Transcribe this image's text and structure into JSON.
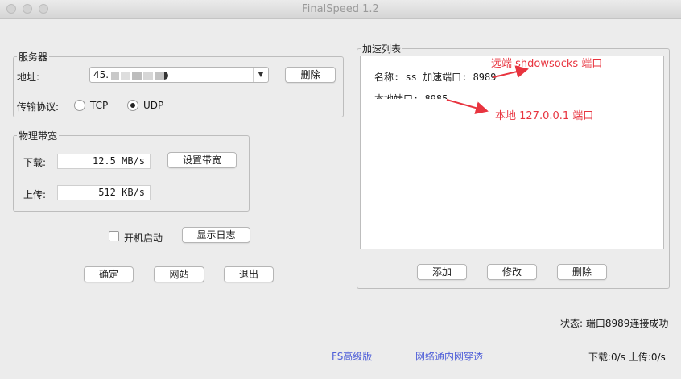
{
  "window": {
    "title": "FinalSpeed 1.2"
  },
  "server": {
    "legend": "服务器",
    "address_label": "地址:",
    "address_value": "45.",
    "delete_label": "删除",
    "protocol_label": "传输协议:",
    "protocol_options": [
      "TCP",
      "UDP"
    ],
    "protocol_selected": "UDP"
  },
  "bandwidth": {
    "legend": "物理带宽",
    "download_label": "下载:",
    "download_value": "12.5 MB/s",
    "upload_label": "上传:",
    "upload_value": "512 KB/s",
    "set_label": "设置带宽"
  },
  "options": {
    "autostart_label": "开机启动",
    "autostart_checked": false,
    "show_log_label": "显示日志"
  },
  "bottom_buttons": {
    "ok": "确定",
    "website": "网站",
    "exit": "退出"
  },
  "accel": {
    "legend": "加速列表",
    "items": [
      {
        "text": "名称: ss  加速端口: 8989"
      },
      {
        "text": "本地端口: 8985"
      }
    ],
    "add_label": "添加",
    "edit_label": "修改",
    "delete_label": "删除"
  },
  "annotations": {
    "remote": "远端 shdowsocks 端口",
    "local": "本地 127.0.0.1 端口",
    "color": "#e8343f"
  },
  "status": {
    "text": "状态: 端口8989连接成功",
    "speed": "下载:0/s 上传:0/s"
  },
  "links": {
    "advanced": "FS高级版",
    "penetrate": "网络通内网穿透",
    "color": "#4f5fd8"
  }
}
